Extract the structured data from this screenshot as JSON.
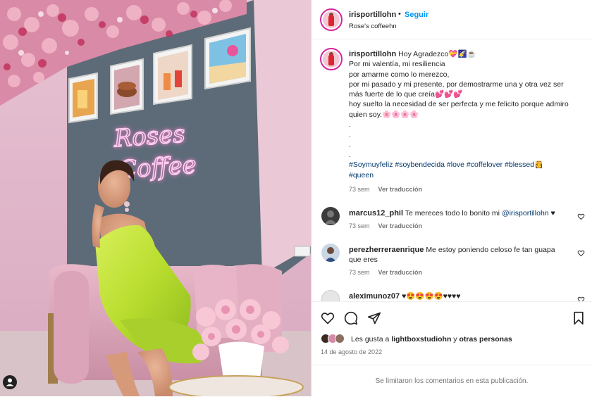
{
  "post": {
    "username": "irisportillohn",
    "follow_dot": "•",
    "follow_label": "Seguir",
    "location": "Rose's coffeehn",
    "more_label": "···"
  },
  "caption": {
    "username": "irisportillohn",
    "text": "Hoy Agradezco💝🌠☕\nPor mi valentía, mi resiliencia\npor amarme como lo merezco,\npor mi pasado y mi presente, por demostrarme una y otra vez ser más fuerte de lo que creía💕💕💕\nhoy suelto la necesidad de ser perfecta y me felicito porque admiro quien soy.🌸🌸🌸🌸\n.\n.\n.\n.",
    "hashtags": "#Soymuyfeliz #soybendecida #love #coffelover #blessed👸 #queen",
    "time": "73 sem",
    "translate": "Ver traducción"
  },
  "comments": [
    {
      "username": "marcus12_phil",
      "text": "Te mereces todo lo bonito mi",
      "mention": "@irisportillohn",
      "suffix": "♥",
      "time": "73 sem",
      "translate": "Ver traducción"
    },
    {
      "username": "perezherreraenrique",
      "text": "Me estoy poniendo celoso fe tan guapa que eres",
      "time": "73 sem",
      "translate": "Ver traducción"
    },
    {
      "username": "aleximunoz07",
      "text": "♥😍😍😍😍♥♥♥♥"
    }
  ],
  "likes": {
    "prefix": "Les gusta a ",
    "user": "lightboxstudiohn",
    "middle": " y ",
    "others": "otras personas"
  },
  "date": "14 de agosto de 2022",
  "comments_limited": "Se limitaron los comentarios en esta publicación.",
  "photo": {
    "sign_line1": "Roses",
    "sign_line2": "Coffee"
  },
  "icons": {
    "like": "heart-icon",
    "comment": "comment-icon",
    "share": "share-icon",
    "save": "bookmark-icon",
    "tag": "user-tag-icon"
  },
  "colors": {
    "follow": "#0095f6",
    "link": "#00376b",
    "muted": "#737373",
    "neon": "#ffb6e6"
  }
}
